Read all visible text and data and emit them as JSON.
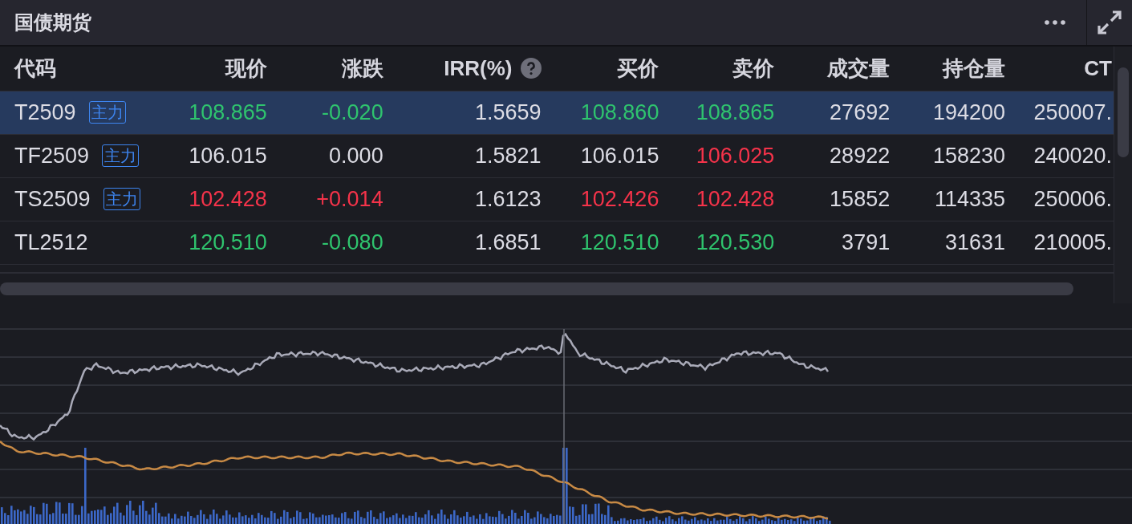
{
  "panel": {
    "title": "国债期货"
  },
  "table": {
    "columns": [
      {
        "label": "代码",
        "help": false
      },
      {
        "label": "现价",
        "help": false
      },
      {
        "label": "涨跌",
        "help": false
      },
      {
        "label": "IRR(%)",
        "help": true
      },
      {
        "label": "买价",
        "help": false
      },
      {
        "label": "卖价",
        "help": false
      },
      {
        "label": "成交量",
        "help": false
      },
      {
        "label": "持仓量",
        "help": false
      },
      {
        "label": "CT",
        "help": false
      }
    ],
    "rows": [
      {
        "selected": true,
        "cells": [
          {
            "text": "T2509",
            "tag": "主力"
          },
          {
            "text": "108.865",
            "color": "#2fc46e"
          },
          {
            "text": "-0.020",
            "color": "#2fc46e"
          },
          {
            "text": "1.5659",
            "color": "#dcdce4"
          },
          {
            "text": "108.860",
            "color": "#2fc46e"
          },
          {
            "text": "108.865",
            "color": "#2fc46e"
          },
          {
            "text": "27692",
            "color": "#dcdce4"
          },
          {
            "text": "194200",
            "color": "#dcdce4"
          },
          {
            "text": "250007.",
            "color": "#dcdce4"
          }
        ]
      },
      {
        "selected": false,
        "cells": [
          {
            "text": "TF2509",
            "tag": "主力"
          },
          {
            "text": "106.015",
            "color": "#dcdce4"
          },
          {
            "text": "0.000",
            "color": "#dcdce4"
          },
          {
            "text": "1.5821",
            "color": "#dcdce4"
          },
          {
            "text": "106.015",
            "color": "#dcdce4"
          },
          {
            "text": "106.025",
            "color": "#f5334a"
          },
          {
            "text": "28922",
            "color": "#dcdce4"
          },
          {
            "text": "158230",
            "color": "#dcdce4"
          },
          {
            "text": "240020.",
            "color": "#dcdce4"
          }
        ]
      },
      {
        "selected": false,
        "cells": [
          {
            "text": "TS2509",
            "tag": "主力"
          },
          {
            "text": "102.428",
            "color": "#f5334a"
          },
          {
            "text": "+0.014",
            "color": "#f5334a"
          },
          {
            "text": "1.6123",
            "color": "#dcdce4"
          },
          {
            "text": "102.426",
            "color": "#f5334a"
          },
          {
            "text": "102.428",
            "color": "#f5334a"
          },
          {
            "text": "15852",
            "color": "#dcdce4"
          },
          {
            "text": "114335",
            "color": "#dcdce4"
          },
          {
            "text": "250006.",
            "color": "#dcdce4"
          }
        ]
      },
      {
        "selected": false,
        "cells": [
          {
            "text": "TL2512"
          },
          {
            "text": "120.510",
            "color": "#2fc46e"
          },
          {
            "text": "-0.080",
            "color": "#2fc46e"
          },
          {
            "text": "1.6851",
            "color": "#dcdce4"
          },
          {
            "text": "120.510",
            "color": "#2fc46e"
          },
          {
            "text": "120.530",
            "color": "#2fc46e"
          },
          {
            "text": "3791",
            "color": "#dcdce4"
          },
          {
            "text": "31631",
            "color": "#dcdce4"
          },
          {
            "text": "210005.",
            "color": "#dcdce4"
          }
        ]
      }
    ]
  }
}
